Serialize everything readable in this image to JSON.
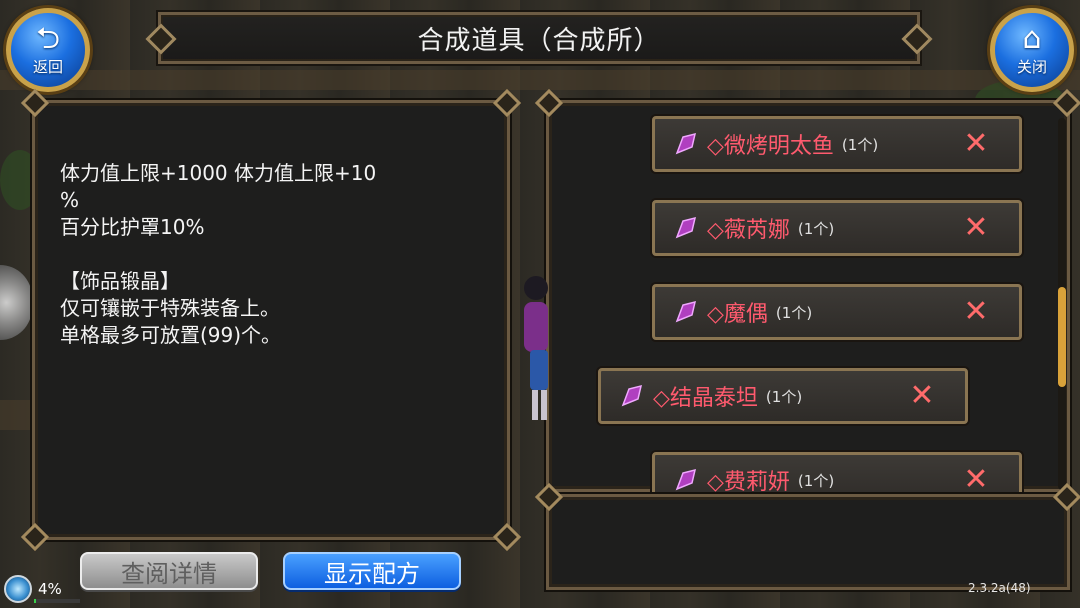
{
  "header": {
    "title": "合成道具（合成所）"
  },
  "nav": {
    "back": {
      "label": "返回",
      "icon": "return-arrow-icon"
    },
    "close": {
      "label": "关闭",
      "icon": "house-icon"
    }
  },
  "description": {
    "lines": [
      "体力值上限+1000 体力值上限+10",
      "%",
      "百分比护罩10%",
      "",
      "【饰品锻晶】",
      "仅可镶嵌于特殊装备上。",
      "单格最多可放置(99)个。"
    ]
  },
  "materials": {
    "items": [
      {
        "name": "◇微烤明太鱼",
        "count": "(1个)"
      },
      {
        "name": "◇薇芮娜",
        "count": "(1个)"
      },
      {
        "name": "◇魔偶",
        "count": "(1个)"
      },
      {
        "name": "◇结晶泰坦",
        "count": "(1个)"
      },
      {
        "name": "◇费莉妍",
        "count": "(1个)"
      }
    ],
    "selected_index": 3,
    "scroll_position": 0.62
  },
  "buttons": {
    "details": "查阅详情",
    "show_recipe": "显示配方"
  },
  "status": {
    "percent": "4%",
    "progress": 0.04,
    "version": "2.3.2a(48)"
  },
  "colors": {
    "item_name": "#ff5a6e",
    "panel_border": "#6b5a42",
    "accent_gold": "#d9a23a",
    "button_blue": "#0d5fe0"
  }
}
